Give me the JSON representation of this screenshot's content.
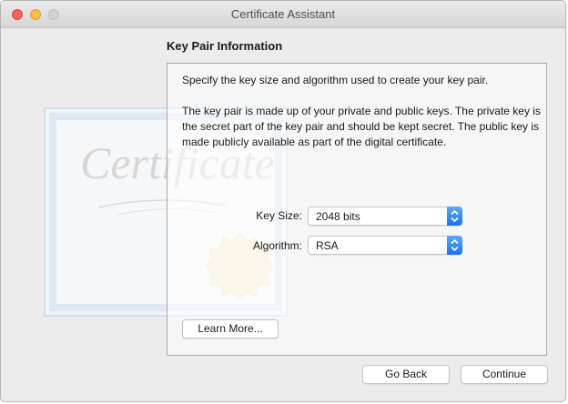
{
  "window": {
    "title": "Certificate Assistant"
  },
  "section": {
    "heading": "Key Pair Information"
  },
  "panel": {
    "intro": "Specify the key size and algorithm used to create your key pair.",
    "description": "The key pair is made up of your private and public keys. The private key is the secret part of the key pair and should be kept secret. The public key is made publicly available as part of the digital certificate.",
    "key_size": {
      "label": "Key Size:",
      "value": "2048 bits"
    },
    "algorithm": {
      "label": "Algorithm:",
      "value": "RSA"
    },
    "learn_more_label": "Learn More..."
  },
  "watermark": {
    "text": "Certificate"
  },
  "footer": {
    "back_label": "Go Back",
    "continue_label": "Continue"
  },
  "colors": {
    "accent": "#1a73f0",
    "close": "#fc605b",
    "minimize": "#fdbc40",
    "zoom_disabled": "#d2d2d2"
  },
  "icons": [
    "close-icon",
    "minimize-icon",
    "zoom-icon",
    "chevron-updown-icon",
    "certificate-seal-icon"
  ]
}
